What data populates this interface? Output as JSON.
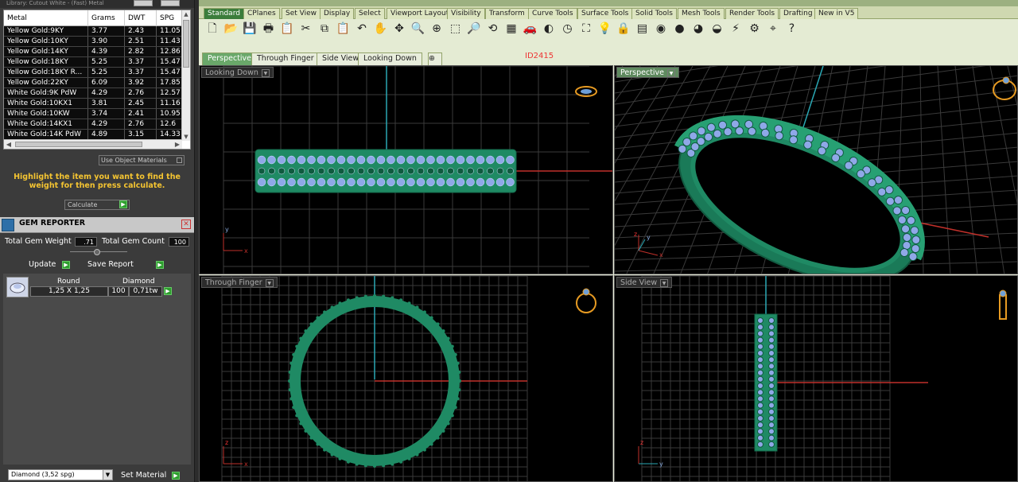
{
  "library": {
    "title": "Library: Cutout White - (Fast) Metal"
  },
  "metal_table": {
    "headers": [
      "Metal",
      "Grams",
      "DWT",
      "SPG"
    ],
    "rows": [
      [
        "Yellow Gold:9KY",
        "3.77",
        "2.43",
        "11.05"
      ],
      [
        "Yellow Gold:10KY",
        "3.90",
        "2.51",
        "11.43"
      ],
      [
        "Yellow Gold:14KY",
        "4.39",
        "2.82",
        "12.86"
      ],
      [
        "Yellow Gold:18KY",
        "5.25",
        "3.37",
        "15.47"
      ],
      [
        "Yellow Gold:18KY R...",
        "5.25",
        "3.37",
        "15.47"
      ],
      [
        "Yellow Gold:22KY",
        "6.09",
        "3.92",
        "17.85"
      ],
      [
        "White Gold:9K PdW",
        "4.29",
        "2.76",
        "12.57"
      ],
      [
        "White Gold:10KX1",
        "3.81",
        "2.45",
        "11.16"
      ],
      [
        "White Gold:10KW",
        "3.74",
        "2.41",
        "10.95"
      ],
      [
        "White Gold:14KX1",
        "4.29",
        "2.76",
        "12.6"
      ],
      [
        "White Gold:14K PdW",
        "4.89",
        "3.15",
        "14.33"
      ]
    ]
  },
  "use_object_materials": "Use Object Materials",
  "hint": "Highlight the item you want to find the weight for then press calculate.",
  "calculate_label": "Calculate",
  "gem_reporter": {
    "title": "GEM REPORTER",
    "total_gem_weight_label": "Total Gem Weight",
    "total_gem_weight": ".71",
    "total_gem_count_label": "Total Gem Count",
    "total_gem_count": "100",
    "update_label": "Update",
    "save_report_label": "Save Report",
    "gems": [
      {
        "shape": "Round",
        "type": "Diamond",
        "size": "1,25 X 1,25",
        "count": "100",
        "weight": "0,71tw"
      }
    ],
    "material_select": "Diamond    (3,52 spg)",
    "set_material_label": "Set Material"
  },
  "tabs": [
    "Standard",
    "CPlanes",
    "Set View",
    "Display",
    "Select",
    "Viewport Layout",
    "Visibility",
    "Transform",
    "Curve Tools",
    "Surface Tools",
    "Solid Tools",
    "Mesh Tools",
    "Render Tools",
    "Drafting",
    "New in V5"
  ],
  "viewport_tabs": [
    "Perspective",
    "Through Finger",
    "Side View",
    "Looking Down"
  ],
  "id_label": "ID2415",
  "viewports": {
    "top_left": "Looking Down",
    "top_right": "Perspective",
    "bottom_left": "Through Finger",
    "bottom_right": "Side View"
  },
  "axis_labels": {
    "x": "x",
    "y": "y",
    "z": "z"
  },
  "colors": {
    "ring": "#1f8a64",
    "gem": "#8fa8e8",
    "axis_red": "#c0302a",
    "axis_cyan": "#2aa8b4",
    "grid": "#3a3a3a",
    "accent": "#f4c431"
  }
}
